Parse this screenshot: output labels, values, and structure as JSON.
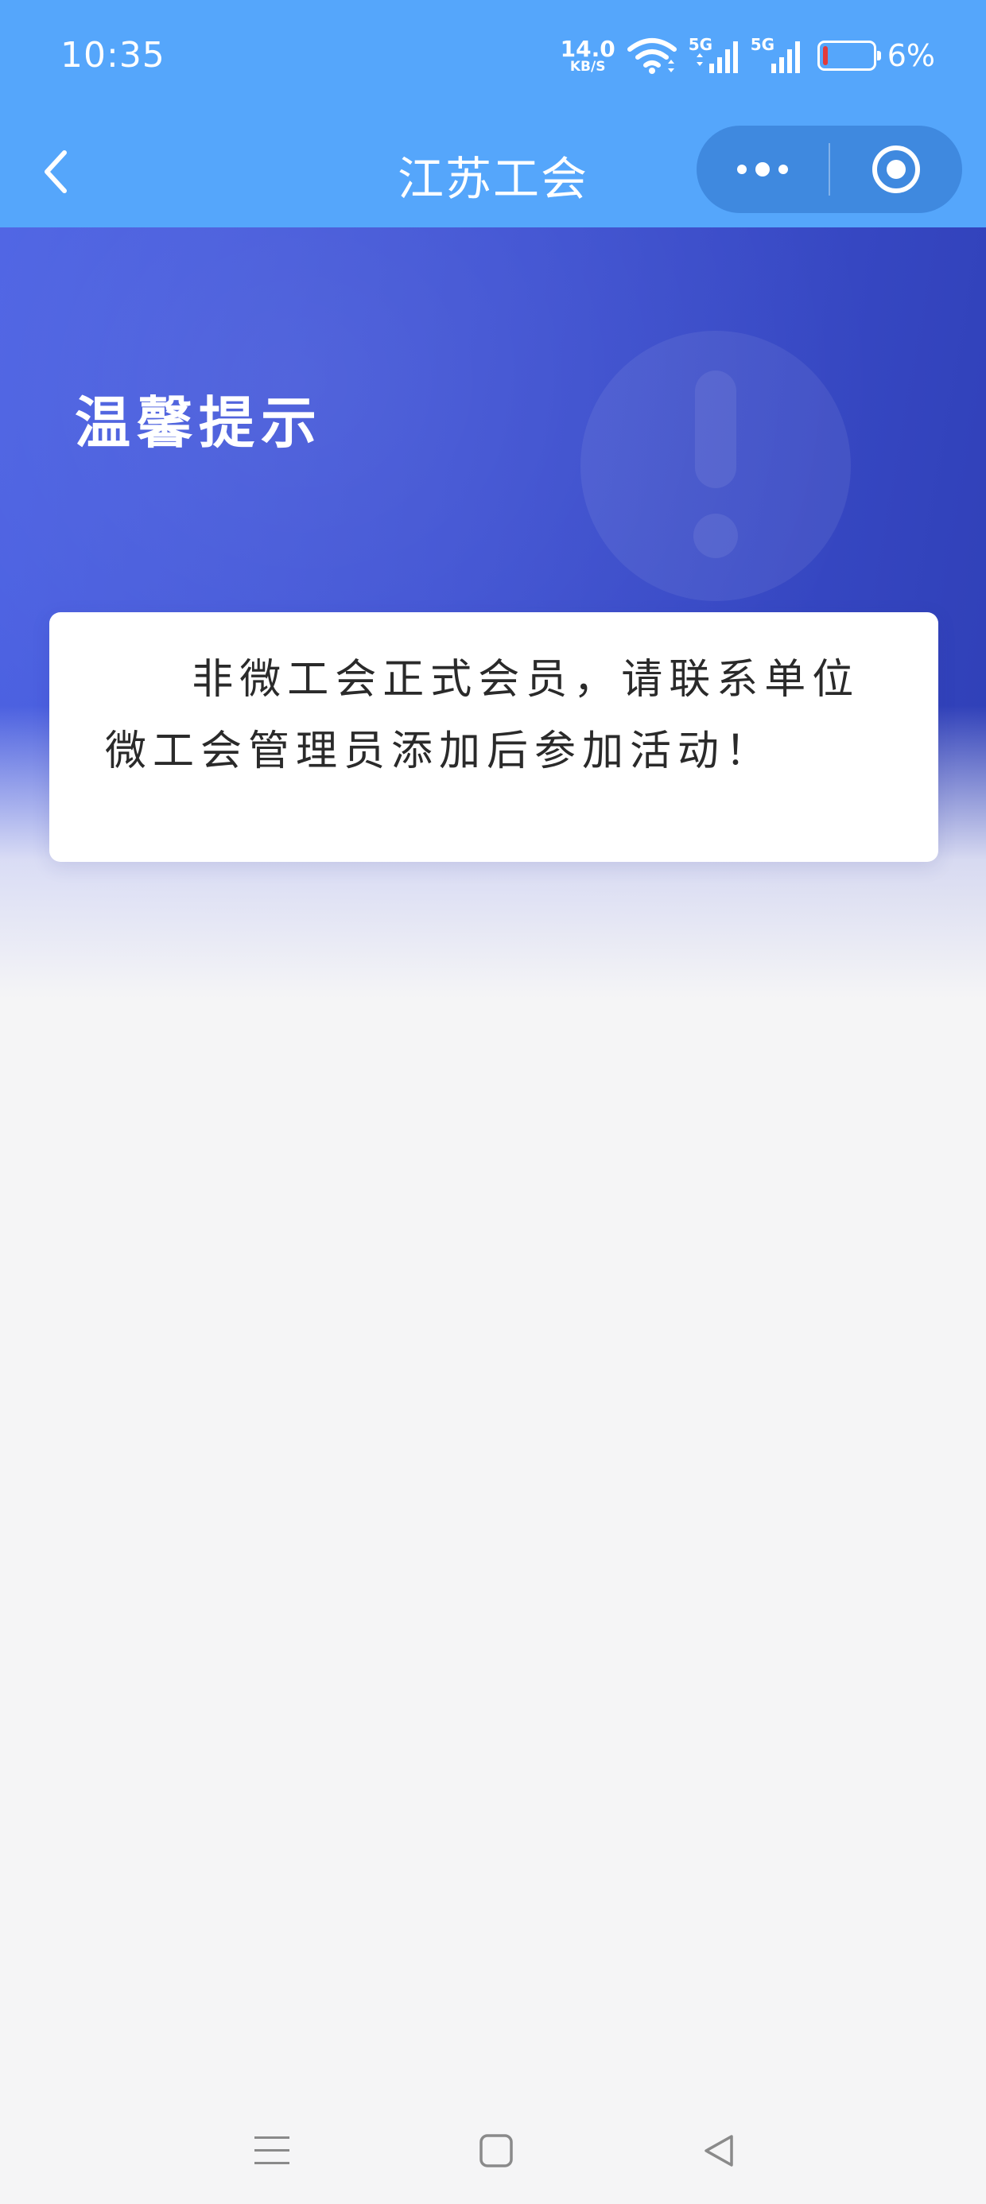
{
  "status_bar": {
    "time": "10:35",
    "net_speed_value": "14.0",
    "net_speed_unit": "KB/S",
    "signal1_label": "5G",
    "signal2_label": "5G",
    "battery_percent": "6%",
    "battery_level": 0.06,
    "battery_low_color": "#e23a3a",
    "icons": [
      "wifi-icon",
      "signal-icon",
      "battery-icon"
    ]
  },
  "nav": {
    "title": "江苏工会",
    "back_icon": "chevron-left-icon",
    "more_icon": "more-dots-icon",
    "close_icon": "target-close-icon"
  },
  "hero": {
    "title": "温馨提示",
    "icon": "exclamation-icon"
  },
  "card": {
    "message": "非微工会正式会员，请联系单位微工会管理员添加后参加活动！"
  },
  "system_nav": {
    "icons": [
      "menu-icon",
      "home-icon",
      "back-triangle-icon"
    ]
  },
  "colors": {
    "top_bar": "#55a6fb",
    "capsule": "#3f89df",
    "hero_start": "#4b61e3",
    "hero_end": "#2f3fb6",
    "page_bg": "#f5f5f6"
  }
}
